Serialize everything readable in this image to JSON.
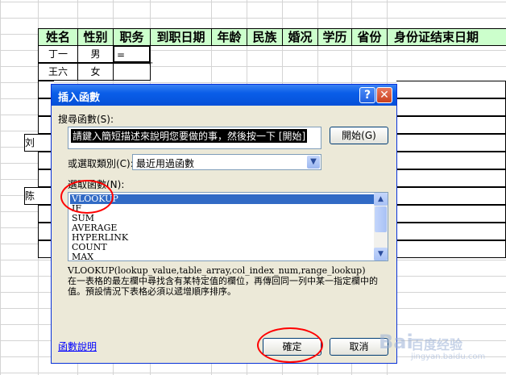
{
  "sheet": {
    "headers": [
      "姓名",
      "性别",
      "职务",
      "到职日期",
      "年龄",
      "民族",
      "婚况",
      "学历",
      "省份",
      "身份证结束日期"
    ],
    "rows": [
      {
        "name": "丁一",
        "gender": "男",
        "job": "="
      },
      {
        "name": "王六",
        "gender": "女",
        "job": ""
      }
    ],
    "partial_left_col": [
      "",
      "",
      "刘",
      "",
      "",
      "",
      "陈",
      "",
      "",
      ""
    ]
  },
  "dialog": {
    "title": "插入函數",
    "help_button": "?",
    "close_button": "✕",
    "search_label": "搜尋函數(S):",
    "search_text": "請鍵入簡短描述來說明您要做的事，然後按一下 [開始]",
    "go_button": "開始(G)",
    "category_label": "或選取類別(C):",
    "category_value": "最近用過函數",
    "function_list_label": "選取函數(N):",
    "functions": [
      "VLOOKUP",
      "IF",
      "SUM",
      "AVERAGE",
      "HYPERLINK",
      "COUNT",
      "MAX"
    ],
    "selected_function": "VLOOKUP",
    "syntax": "VLOOKUP(lookup_value,table_array,col_index_num,range_lookup)",
    "description": "在一表格的最左欄中尋找含有某特定值的欄位，再傳回同一列中某一指定欄中的值。預設情況下表格必須以遞增順序排序。",
    "help_link": "函數說明",
    "ok_button": "確定",
    "cancel_button": "取消"
  },
  "watermark": {
    "logo": "Bai",
    "text": "百度经验",
    "url": "jingyan.baidu.com"
  },
  "colors": {
    "header_bg": "#ccffcc",
    "titlebar": "#0a5ee8",
    "selection": "#316ac5",
    "annotation": "#ff0000"
  }
}
